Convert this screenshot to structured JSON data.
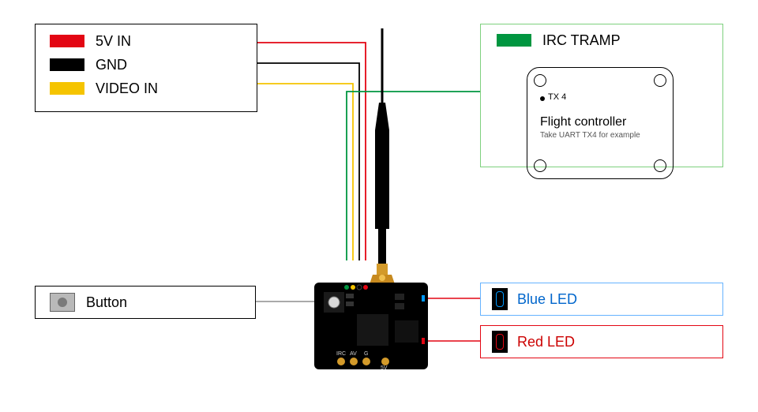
{
  "inputs": {
    "five_v": {
      "label": "5V IN",
      "color": "#e30613"
    },
    "gnd": {
      "label": "GND",
      "color": "#000000"
    },
    "video": {
      "label": "VIDEO IN",
      "color": "#f5c400"
    }
  },
  "irc": {
    "label": "IRC TRAMP",
    "color": "#009640"
  },
  "button": {
    "label": "Button"
  },
  "blue_led": {
    "label": "Blue LED",
    "color": "#0099ff",
    "text_color": "#0066cc"
  },
  "red_led": {
    "label": "Red LED",
    "color": "#e30613",
    "text_color": "#cc0000"
  },
  "fc": {
    "tx_label": "TX 4",
    "title": "Flight controller",
    "subtitle": "Take UART TX4 for example"
  },
  "pcb": {
    "silks": {
      "irc": "IRC",
      "av": "AV",
      "g": "G",
      "fv": "5V"
    }
  }
}
